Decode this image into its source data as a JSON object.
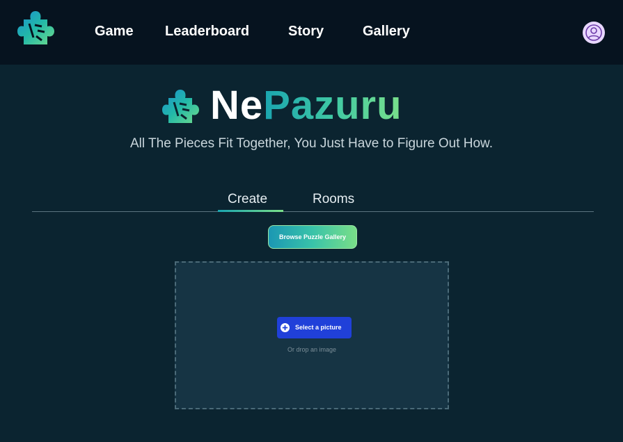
{
  "nav": {
    "items": [
      "Game",
      "Leaderboard",
      "Story",
      "Gallery"
    ]
  },
  "brand": {
    "title_part1": "Ne",
    "title_part2": "Pazuru",
    "tagline": "All The Pieces Fit Together, You Just Have to Figure Out How."
  },
  "tabs": {
    "items": [
      "Create",
      "Rooms"
    ],
    "active": "Create"
  },
  "actions": {
    "browse_gallery": "Browse Puzzle Gallery"
  },
  "upload": {
    "select_label": "Select a picture",
    "hint": "Or drop an image"
  },
  "icons": {
    "logo": "puzzle-piece-icon",
    "avatar": "user-icon",
    "select": "plus-circle-icon"
  },
  "colors": {
    "topbar": "#06131f",
    "background": "#0b2430",
    "accent_start": "#1aa5b0",
    "accent_end": "#7ae08a",
    "primary_button": "#2040d9",
    "avatar_bg": "#e8d7ff"
  }
}
